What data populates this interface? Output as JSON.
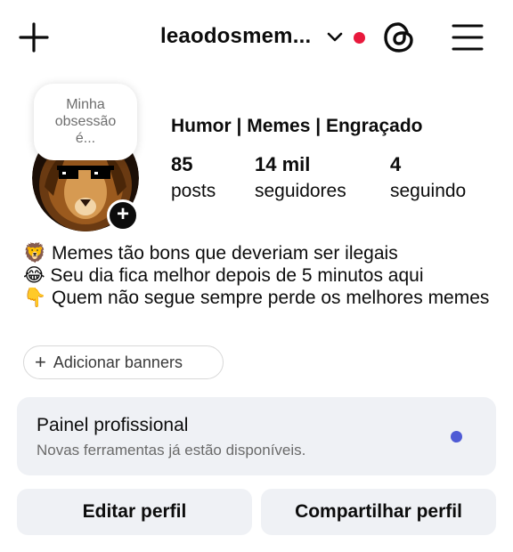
{
  "header": {
    "username": "leaodosmem...",
    "accent_dot_color": "#e8193c"
  },
  "profile": {
    "note": [
      "Minha",
      "obsessão",
      "é..."
    ],
    "category": "Humor | Memes | Engraçado",
    "stats": [
      {
        "value": "85",
        "label": "posts"
      },
      {
        "value": "14 mil",
        "label": "seguidores"
      },
      {
        "value": "4",
        "label": "seguindo"
      }
    ],
    "bio": [
      {
        "emoji": "🦁",
        "text": "Memes tão bons que deveriam ser ilegais"
      },
      {
        "emoji": "😂",
        "text": "Seu dia fica melhor depois de 5 minutos aqui"
      },
      {
        "emoji": "👇",
        "text": "Quem não segue sempre perde os melhores memes"
      }
    ],
    "add_banners_label": "Adicionar banners"
  },
  "professional_panel": {
    "title": "Painel profissional",
    "subtitle": "Novas ferramentas já estão disponíveis.",
    "dot_color": "#4f5bd5"
  },
  "actions": {
    "edit_label": "Editar perfil",
    "share_label": "Compartilhar perfil"
  }
}
